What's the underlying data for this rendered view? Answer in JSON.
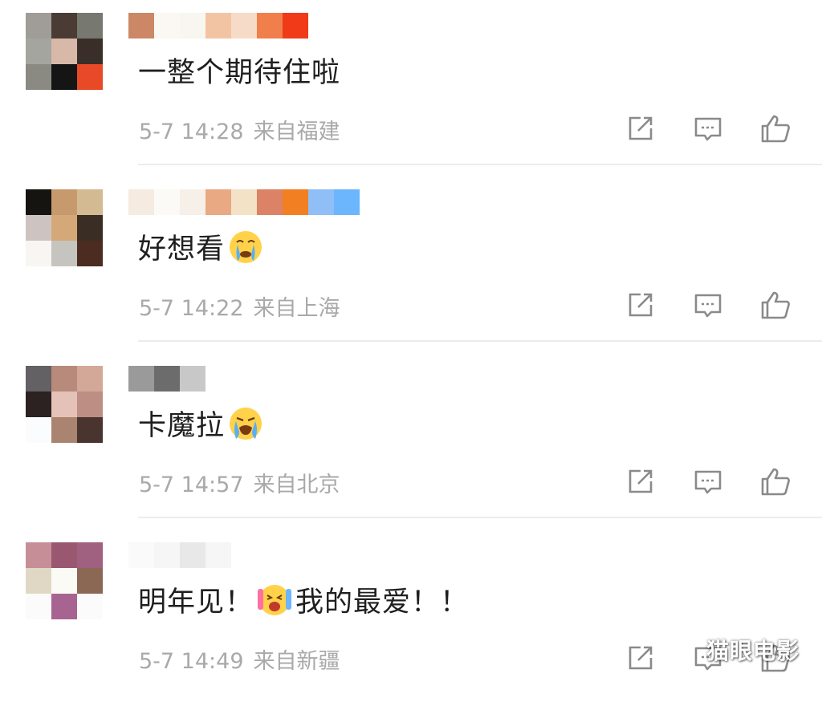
{
  "comments": [
    {
      "text": "一整个期待住啦",
      "emoji_after": "",
      "text2": "",
      "time": "5-7 14:28",
      "location": "来自福建",
      "avatar_colors": [
        "#a09c97",
        "#4a3c34",
        "#777870",
        "#a4a59f",
        "#d8b8a8",
        "#3a2e28",
        "#8b8a82",
        "#151515",
        "#e84a28"
      ],
      "name_colors": [
        "#cc8866",
        "#fbf8f4",
        "#f8f6f0",
        "#f3c4a4",
        "#f6dcc8",
        "#f07f4c",
        "#f03a18"
      ]
    },
    {
      "text": "好想看",
      "emoji_after": "crying-face-emoji",
      "text2": "",
      "time": "5-7 14:22",
      "location": "来自上海",
      "avatar_colors": [
        "#161410",
        "#c79a6d",
        "#d3ba92",
        "#cdc4c2",
        "#d4a878",
        "#3a2e24",
        "#f7f6f2",
        "#c6c4be",
        "#4c2c20"
      ],
      "name_colors": [
        "#f5ebe0",
        "#fbfaf6",
        "#f6f0e8",
        "#e9a982",
        "#f3e2c6",
        "#dc8266",
        "#f27f22",
        "#90bef7",
        "#6bb6fc"
      ]
    },
    {
      "text": "卡魔拉",
      "emoji_after": "sobbing-face-emoji",
      "text2": "",
      "time": "5-7 14:57",
      "location": "来自北京",
      "avatar_colors": [
        "#636163",
        "#b78a7c",
        "#d3a898",
        "#2c2222",
        "#e4c2b8",
        "#bc8e84",
        "#fafcfd",
        "#aa8470",
        "#4a3430"
      ],
      "name_colors": [
        "#9a9a9a",
        "#6c6c6c",
        "#c8c8c8"
      ]
    },
    {
      "text": "明年见！",
      "emoji_after": "screaming-face-emoji",
      "text2": "我的最爱！！",
      "time": "5-7 14:49",
      "location": "来自新疆",
      "avatar_colors": [
        "#c68e96",
        "#9a5870",
        "#a06080",
        "#e0d8c4",
        "#fbfbf6",
        "#8a6854",
        "#fbfbfb",
        "#a86490",
        "#fbfbfb"
      ],
      "name_colors": [
        "#fafafa",
        "#f6f6f6",
        "#e8e8e8",
        "#f6f6f6"
      ]
    }
  ],
  "watermark": "猫眼电影",
  "icons": {
    "share": "share-icon",
    "reply": "comment-icon",
    "like": "thumbs-up-icon"
  },
  "colors": {
    "text": "#1f1f1f",
    "meta": "#a9a9a9",
    "icon": "#8a8a8a",
    "divider": "#ececec"
  }
}
